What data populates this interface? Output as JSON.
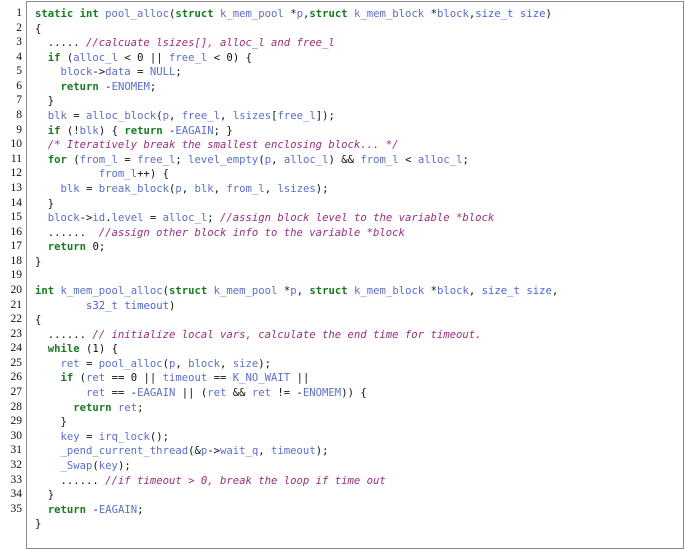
{
  "document": {
    "type": "source-code-listing",
    "language": "C",
    "line_number_start": 1,
    "line_number_end": 35,
    "colors": {
      "keyword": "#1a7a22",
      "identifier": "#5c6fc9",
      "identifier_bright": "#4a63d8",
      "comment": "#9b2d7f",
      "plain": "#111111",
      "border": "#8a8a8a",
      "background": "#ffffff",
      "line_number": "#101010"
    }
  },
  "line_numbers": [
    "1",
    "2",
    "3",
    "4",
    "5",
    "6",
    "7",
    "8",
    "9",
    "10",
    "11",
    "12",
    "13",
    "14",
    "15",
    "16",
    "17",
    "18",
    "19",
    "20",
    "21",
    "22",
    "23",
    "24",
    "25",
    "26",
    "27",
    "28",
    "29",
    "30",
    "31",
    "32",
    "33",
    "34",
    "35"
  ],
  "code_lines": [
    "static int pool_alloc(struct k_mem_pool *p,struct k_mem_block *block,size_t size)",
    "{",
    "  ..... //calcuate lsizes[], alloc_l and free_l",
    "  if (alloc_l < 0 || free_l < 0) {",
    "    block->data = NULL;",
    "    return -ENOMEM;",
    "  }",
    "  blk = alloc_block(p, free_l, lsizes[free_l]);",
    "  if (!blk) { return -EAGAIN; }",
    "  /* Iteratively break the smallest enclosing block... */",
    "  for (from_l = free_l; level_empty(p, alloc_l) && from_l < alloc_l;",
    "          from_l++) {",
    "    blk = break_block(p, blk, from_l, lsizes);",
    "  }",
    "  block->id.level = alloc_l; //assign block level to the variable *block",
    "  ......  //assign other block info to the variable *block",
    "  return 0;",
    "}",
    "",
    "int k_mem_pool_alloc(struct k_mem_pool *p, struct k_mem_block *block, size_t size,",
    "        s32_t timeout)",
    "{",
    "  ...... // initialize local vars, calculate the end time for timeout.",
    "  while (1) {",
    "    ret = pool_alloc(p, block, size);",
    "    if (ret == 0 || timeout == K_NO_WAIT ||",
    "        ret == -EAGAIN || (ret && ret != -ENOMEM)) {",
    "      return ret;",
    "    }",
    "    key = irq_lock();",
    "    _pend_current_thread(&p->wait_q, timeout);",
    "    _Swap(key);",
    "    ...... //if timeout > 0, break the loop if time out",
    "  }",
    "  return -EAGAIN;",
    "}"
  ],
  "tokens": [
    [
      [
        "static ",
        "kw"
      ],
      [
        "int ",
        "kw"
      ],
      [
        "pool_alloc",
        "id"
      ],
      [
        "(",
        "pl"
      ],
      [
        "struct",
        "kw"
      ],
      [
        " ",
        "pl"
      ],
      [
        "k_mem_pool",
        "id"
      ],
      [
        " ",
        "pl"
      ],
      [
        "*",
        "pl"
      ],
      [
        "p",
        "id"
      ],
      [
        ",",
        "pl"
      ],
      [
        "struct",
        "kw"
      ],
      [
        " ",
        "pl"
      ],
      [
        "k_mem_block",
        "id"
      ],
      [
        " ",
        "pl"
      ],
      [
        "*",
        "pl"
      ],
      [
        "block",
        "id"
      ],
      [
        ",",
        "pl"
      ],
      [
        "size_t",
        "id2"
      ],
      [
        " ",
        "pl"
      ],
      [
        "size",
        "id2"
      ],
      [
        ")",
        "pl"
      ]
    ],
    [
      [
        "{",
        "pl"
      ]
    ],
    [
      [
        "  ..... ",
        "pl"
      ],
      [
        "//calcuate lsizes[], alloc_l and free_l",
        "cm"
      ]
    ],
    [
      [
        "  ",
        "pl"
      ],
      [
        "if",
        "kw"
      ],
      [
        " (",
        "pl"
      ],
      [
        "alloc_l",
        "id"
      ],
      [
        " < ",
        "pl"
      ],
      [
        "0",
        "pl"
      ],
      [
        " || ",
        "pl"
      ],
      [
        "free_l",
        "id"
      ],
      [
        " < ",
        "pl"
      ],
      [
        "0",
        "pl"
      ],
      [
        ") {",
        "pl"
      ]
    ],
    [
      [
        "    ",
        "pl"
      ],
      [
        "block",
        "id"
      ],
      [
        "->",
        "pl"
      ],
      [
        "data",
        "id"
      ],
      [
        " = ",
        "pl"
      ],
      [
        "NULL",
        "cnst"
      ],
      [
        ";",
        "pl"
      ]
    ],
    [
      [
        "    ",
        "pl"
      ],
      [
        "return",
        "kw"
      ],
      [
        " -",
        "pl"
      ],
      [
        "ENOMEM",
        "cnst"
      ],
      [
        ";",
        "pl"
      ]
    ],
    [
      [
        "  }",
        "pl"
      ]
    ],
    [
      [
        "  ",
        "pl"
      ],
      [
        "blk",
        "id"
      ],
      [
        " = ",
        "pl"
      ],
      [
        "alloc_block",
        "id"
      ],
      [
        "(",
        "pl"
      ],
      [
        "p",
        "id"
      ],
      [
        ", ",
        "pl"
      ],
      [
        "free_l",
        "id"
      ],
      [
        ", ",
        "pl"
      ],
      [
        "lsizes",
        "id"
      ],
      [
        "[",
        "pl"
      ],
      [
        "free_l",
        "id"
      ],
      [
        "]);",
        "pl"
      ]
    ],
    [
      [
        "  ",
        "pl"
      ],
      [
        "if",
        "kw"
      ],
      [
        " (!",
        "pl"
      ],
      [
        "blk",
        "id"
      ],
      [
        ") { ",
        "pl"
      ],
      [
        "return",
        "kw"
      ],
      [
        " -",
        "pl"
      ],
      [
        "EAGAIN",
        "cnst"
      ],
      [
        "; }",
        "pl"
      ]
    ],
    [
      [
        "  ",
        "pl"
      ],
      [
        "/* Iteratively break the smallest enclosing block... */",
        "cm"
      ]
    ],
    [
      [
        "  ",
        "pl"
      ],
      [
        "for",
        "kw"
      ],
      [
        " (",
        "pl"
      ],
      [
        "from_l",
        "id"
      ],
      [
        " = ",
        "pl"
      ],
      [
        "free_l",
        "id"
      ],
      [
        "; ",
        "pl"
      ],
      [
        "level_empty",
        "id"
      ],
      [
        "(",
        "pl"
      ],
      [
        "p",
        "id"
      ],
      [
        ", ",
        "pl"
      ],
      [
        "alloc_l",
        "id"
      ],
      [
        ") && ",
        "pl"
      ],
      [
        "from_l",
        "id"
      ],
      [
        " < ",
        "pl"
      ],
      [
        "alloc_l",
        "id"
      ],
      [
        ";",
        "pl"
      ]
    ],
    [
      [
        "          ",
        "pl"
      ],
      [
        "from_l",
        "id"
      ],
      [
        "++) {",
        "pl"
      ]
    ],
    [
      [
        "    ",
        "pl"
      ],
      [
        "blk",
        "id"
      ],
      [
        " = ",
        "pl"
      ],
      [
        "break_block",
        "id"
      ],
      [
        "(",
        "pl"
      ],
      [
        "p",
        "id"
      ],
      [
        ", ",
        "pl"
      ],
      [
        "blk",
        "id"
      ],
      [
        ", ",
        "pl"
      ],
      [
        "from_l",
        "id"
      ],
      [
        ", ",
        "pl"
      ],
      [
        "lsizes",
        "id"
      ],
      [
        ");",
        "pl"
      ]
    ],
    [
      [
        "  }",
        "pl"
      ]
    ],
    [
      [
        "  ",
        "pl"
      ],
      [
        "block",
        "id"
      ],
      [
        "->",
        "pl"
      ],
      [
        "id",
        "id"
      ],
      [
        ".",
        "pl"
      ],
      [
        "level",
        "id"
      ],
      [
        " = ",
        "pl"
      ],
      [
        "alloc_l",
        "id"
      ],
      [
        "; ",
        "pl"
      ],
      [
        "//assign block level to the variable *block",
        "cm"
      ]
    ],
    [
      [
        "  ......  ",
        "pl"
      ],
      [
        "//assign other block info to the variable *block",
        "cm"
      ]
    ],
    [
      [
        "  ",
        "pl"
      ],
      [
        "return",
        "kw"
      ],
      [
        " ",
        "pl"
      ],
      [
        "0",
        "pl"
      ],
      [
        ";",
        "pl"
      ]
    ],
    [
      [
        "}",
        "pl"
      ]
    ],
    [
      [
        "",
        "pl"
      ]
    ],
    [
      [
        "int",
        "kw"
      ],
      [
        " ",
        "pl"
      ],
      [
        "k_mem_pool_alloc",
        "id"
      ],
      [
        "(",
        "pl"
      ],
      [
        "struct",
        "kw"
      ],
      [
        " ",
        "pl"
      ],
      [
        "k_mem_pool",
        "id"
      ],
      [
        " ",
        "pl"
      ],
      [
        "*",
        "pl"
      ],
      [
        "p",
        "id"
      ],
      [
        ", ",
        "pl"
      ],
      [
        "struct",
        "kw"
      ],
      [
        " ",
        "pl"
      ],
      [
        "k_mem_block",
        "id"
      ],
      [
        " ",
        "pl"
      ],
      [
        "*",
        "pl"
      ],
      [
        "block",
        "id"
      ],
      [
        ", ",
        "pl"
      ],
      [
        "size_t",
        "id2"
      ],
      [
        " ",
        "pl"
      ],
      [
        "size",
        "id2"
      ],
      [
        ",",
        "pl"
      ]
    ],
    [
      [
        "        ",
        "pl"
      ],
      [
        "s32_t",
        "id2"
      ],
      [
        " ",
        "pl"
      ],
      [
        "timeout",
        "id2"
      ],
      [
        ")",
        "pl"
      ]
    ],
    [
      [
        "{",
        "pl"
      ]
    ],
    [
      [
        "  ...... ",
        "pl"
      ],
      [
        "// initialize local vars, calculate the end time for timeout.",
        "cm"
      ]
    ],
    [
      [
        "  ",
        "pl"
      ],
      [
        "while",
        "kw"
      ],
      [
        " (",
        "pl"
      ],
      [
        "1",
        "pl"
      ],
      [
        ") {",
        "pl"
      ]
    ],
    [
      [
        "    ",
        "pl"
      ],
      [
        "ret",
        "id"
      ],
      [
        " = ",
        "pl"
      ],
      [
        "pool_alloc",
        "id"
      ],
      [
        "(",
        "pl"
      ],
      [
        "p",
        "id"
      ],
      [
        ", ",
        "pl"
      ],
      [
        "block",
        "id"
      ],
      [
        ", ",
        "pl"
      ],
      [
        "size",
        "id"
      ],
      [
        ");",
        "pl"
      ]
    ],
    [
      [
        "    ",
        "pl"
      ],
      [
        "if",
        "kw"
      ],
      [
        " (",
        "pl"
      ],
      [
        "ret",
        "id"
      ],
      [
        " == ",
        "pl"
      ],
      [
        "0",
        "pl"
      ],
      [
        " || ",
        "pl"
      ],
      [
        "timeout",
        "id"
      ],
      [
        " == ",
        "pl"
      ],
      [
        "K_NO_WAIT",
        "cnst"
      ],
      [
        " ||",
        "pl"
      ]
    ],
    [
      [
        "        ",
        "pl"
      ],
      [
        "ret",
        "id"
      ],
      [
        " == -",
        "pl"
      ],
      [
        "EAGAIN",
        "cnst"
      ],
      [
        " || (",
        "pl"
      ],
      [
        "ret",
        "id"
      ],
      [
        " && ",
        "pl"
      ],
      [
        "ret",
        "id"
      ],
      [
        " != -",
        "pl"
      ],
      [
        "ENOMEM",
        "cnst"
      ],
      [
        ")) {",
        "pl"
      ]
    ],
    [
      [
        "      ",
        "pl"
      ],
      [
        "return",
        "kw"
      ],
      [
        " ",
        "pl"
      ],
      [
        "ret",
        "id"
      ],
      [
        ";",
        "pl"
      ]
    ],
    [
      [
        "    }",
        "pl"
      ]
    ],
    [
      [
        "    ",
        "pl"
      ],
      [
        "key",
        "id"
      ],
      [
        " = ",
        "pl"
      ],
      [
        "irq_lock",
        "id"
      ],
      [
        "();",
        "pl"
      ]
    ],
    [
      [
        "    ",
        "pl"
      ],
      [
        "_pend_current_thread",
        "id"
      ],
      [
        "(&",
        "pl"
      ],
      [
        "p",
        "id"
      ],
      [
        "->",
        "pl"
      ],
      [
        "wait_q",
        "id"
      ],
      [
        ", ",
        "pl"
      ],
      [
        "timeout",
        "id"
      ],
      [
        ");",
        "pl"
      ]
    ],
    [
      [
        "    ",
        "pl"
      ],
      [
        "_Swap",
        "id"
      ],
      [
        "(",
        "pl"
      ],
      [
        "key",
        "id"
      ],
      [
        ");",
        "pl"
      ]
    ],
    [
      [
        "    ...... ",
        "pl"
      ],
      [
        "//if timeout > 0, break the loop if time out",
        "cm"
      ]
    ],
    [
      [
        "  }",
        "pl"
      ]
    ],
    [
      [
        "  ",
        "pl"
      ],
      [
        "return",
        "kw"
      ],
      [
        " -",
        "pl"
      ],
      [
        "EAGAIN",
        "cnst"
      ],
      [
        ";",
        "pl"
      ]
    ],
    [
      [
        "}",
        "pl"
      ]
    ]
  ]
}
